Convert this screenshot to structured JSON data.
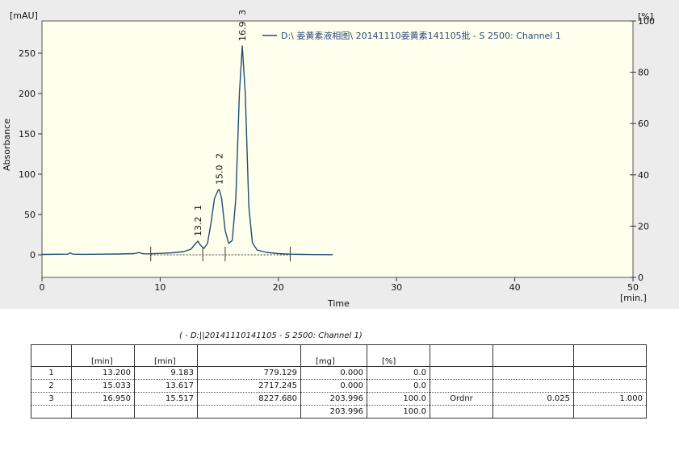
{
  "chart_data": {
    "type": "line",
    "xlabel": "Time",
    "ylabel": "Absorbance",
    "x_unit": "[min.]",
    "y_unit": "[mAU]",
    "y2_unit": "[%]",
    "xlim": [
      0,
      50
    ],
    "ylim": [
      -28,
      290
    ],
    "y2lim": [
      0,
      100
    ],
    "xticks": [
      0,
      10,
      20,
      30,
      40,
      50
    ],
    "yticks": [
      0,
      50,
      100,
      150,
      200,
      250
    ],
    "y2ticks": [
      0,
      20,
      40,
      60,
      80,
      100
    ],
    "grid": false,
    "legend_position": "top-right",
    "series": [
      {
        "name": "D:\\ 姜黄素液相图\\ 20141110姜黄素141105批 - S 2500: Channel 1",
        "color": "#1f4f6f",
        "x": [
          0,
          2.2,
          2.4,
          2.6,
          3.5,
          5,
          6.5,
          7.8,
          8.2,
          8.6,
          9.2,
          10,
          11,
          12,
          12.6,
          13.0,
          13.2,
          13.4,
          13.7,
          14.0,
          14.3,
          14.6,
          14.9,
          15.0,
          15.2,
          15.5,
          15.8,
          16.1,
          16.4,
          16.7,
          16.95,
          17.2,
          17.5,
          17.8,
          18.2,
          19,
          20,
          21,
          22,
          23,
          24.6
        ],
        "y": [
          0.5,
          0.8,
          2.5,
          0.8,
          0.6,
          0.8,
          1.0,
          1.5,
          2.8,
          1.2,
          1.3,
          1.8,
          2.5,
          4.0,
          7.0,
          14.0,
          17.0,
          12.0,
          8.0,
          14.0,
          40.0,
          70.0,
          80.0,
          81.0,
          70.0,
          30.0,
          14.0,
          18.0,
          70.0,
          200.0,
          259.0,
          200.0,
          60.0,
          15.0,
          6.0,
          3.0,
          1.5,
          0.8,
          0.5,
          0.3,
          0.2
        ]
      }
    ],
    "baseline": {
      "x_start": 9.2,
      "x_end": 21.0,
      "y": 0
    },
    "integration_marks": [
      9.2,
      13.6,
      15.5,
      21.0
    ],
    "peaks": [
      {
        "number": "1",
        "rt": "13.2",
        "rt_value": 13.2,
        "height": 17
      },
      {
        "number": "2",
        "rt": "15.0",
        "rt_value": 15.0,
        "height": 81
      },
      {
        "number": "3",
        "rt": "16.9",
        "rt_value": 16.95,
        "height": 259
      }
    ]
  },
  "results": {
    "caption": "( - D:||20141110141105 - S 2500: Channel 1)",
    "units": [
      "",
      "[min]",
      "[min]",
      "",
      "[mg]",
      "[%]",
      "",
      "",
      ""
    ],
    "rows": [
      [
        "1",
        "13.200",
        "9.183",
        "779.129",
        "0.000",
        "0.0",
        "",
        "",
        ""
      ],
      [
        "2",
        "15.033",
        "13.617",
        "2717.245",
        "0.000",
        "0.0",
        "",
        "",
        ""
      ],
      [
        "3",
        "16.950",
        "15.517",
        "8227.680",
        "203.996",
        "100.0",
        "Ordnr",
        "0.025",
        "1.000"
      ],
      [
        "",
        "",
        "",
        "",
        "203.996",
        "100.0",
        "",
        "",
        ""
      ]
    ]
  }
}
